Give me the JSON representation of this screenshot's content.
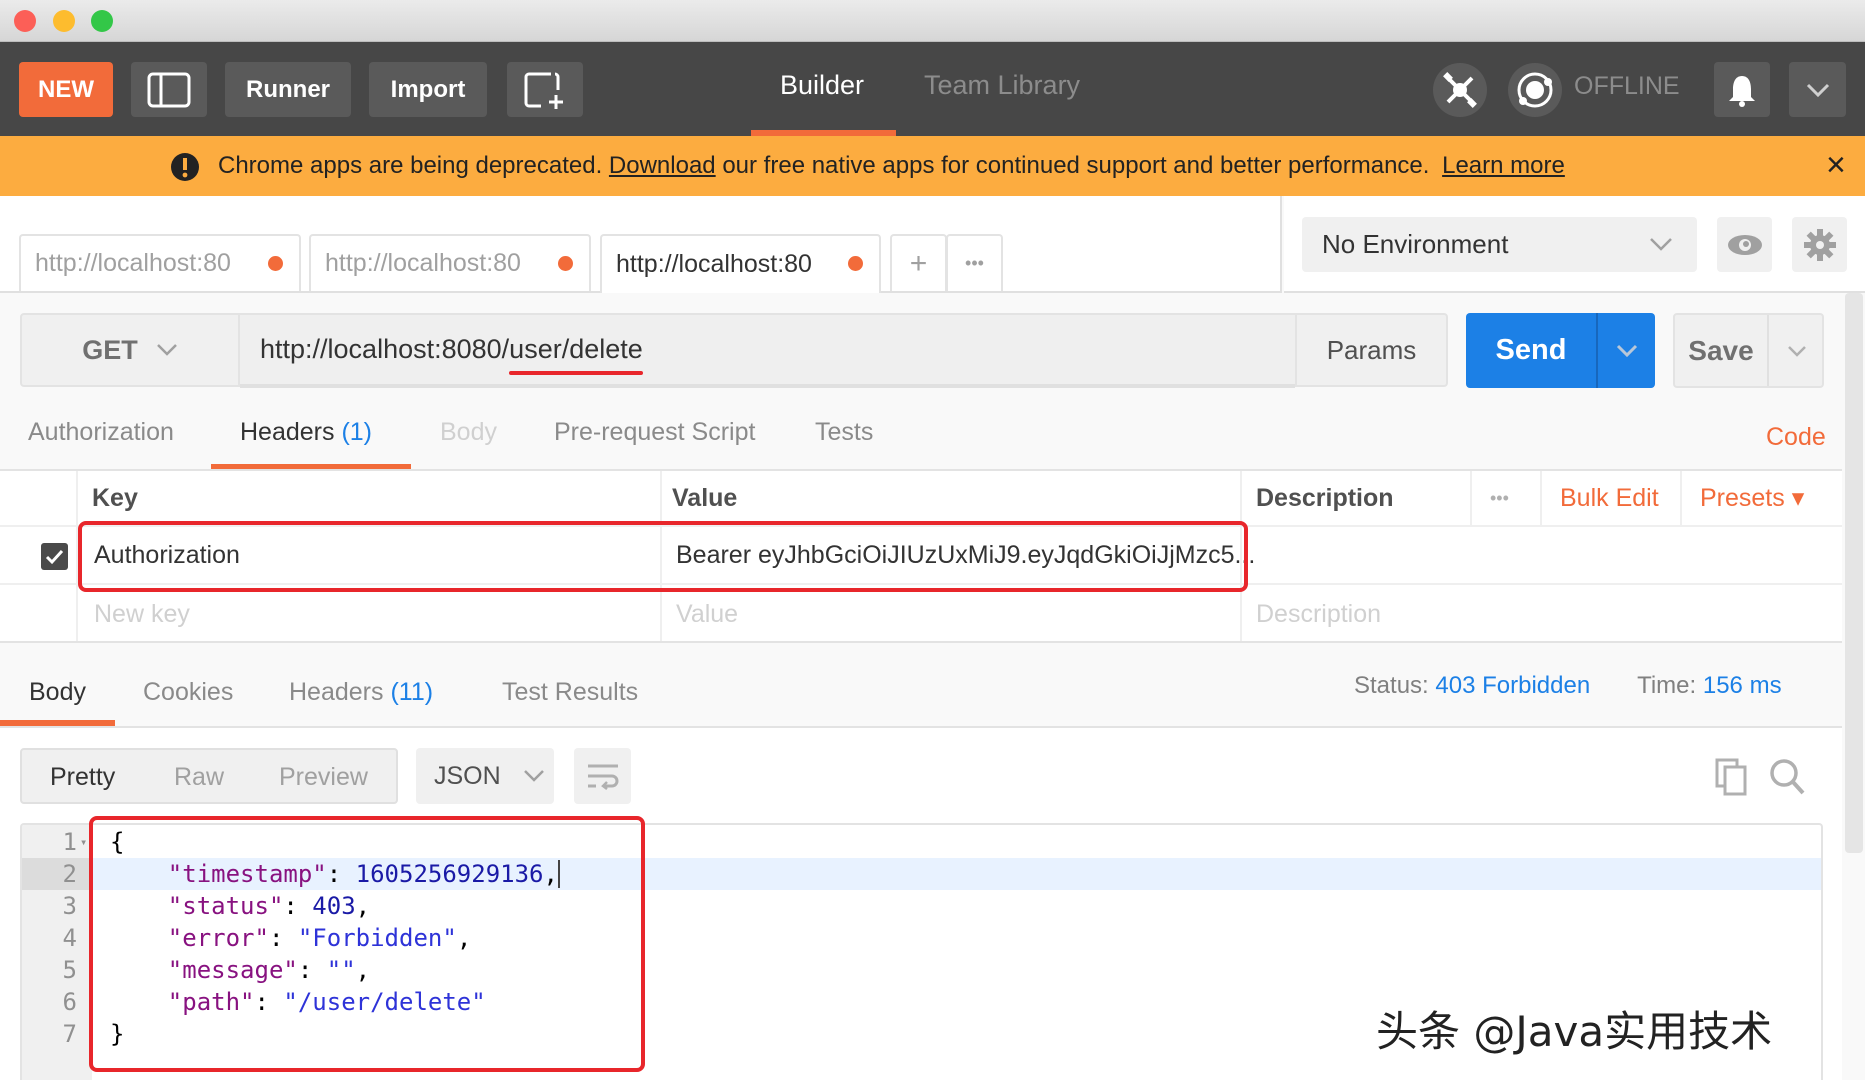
{
  "window": {
    "traffic_lights": [
      "#fc5f57",
      "#fdbc2e",
      "#33c748"
    ]
  },
  "topnav": {
    "new_label": "NEW",
    "runner_label": "Runner",
    "import_label": "Import",
    "tabs": [
      {
        "label": "Builder",
        "active": true
      },
      {
        "label": "Team Library",
        "active": false
      }
    ],
    "status_label": "OFFLINE",
    "accent": "#f26b3a"
  },
  "banner": {
    "text_before": "Chrome apps are being deprecated.",
    "download_link": "Download",
    "text_after": "our free native apps for continued support and better performance.",
    "learn_more_link": "Learn more",
    "close_label": "×"
  },
  "request_tabs": [
    {
      "label": "http://localhost:80",
      "active": false,
      "unsaved": true
    },
    {
      "label": "http://localhost:80",
      "active": false,
      "unsaved": true
    },
    {
      "label": "http://localhost:80",
      "active": true,
      "unsaved": true
    }
  ],
  "request_tab_actions": {
    "add": "+",
    "more": "•••"
  },
  "environment": {
    "selected": "No Environment"
  },
  "request": {
    "method": "GET",
    "url_base": "http://localhost:8080/",
    "url_path": "user/delete",
    "params_label": "Params",
    "send_label": "Send",
    "save_label": "Save"
  },
  "request_subtabs": [
    {
      "label": "Authorization",
      "count": null,
      "state": "normal"
    },
    {
      "label": "Headers",
      "count": "(1)",
      "state": "active"
    },
    {
      "label": "Body",
      "count": null,
      "state": "disabled"
    },
    {
      "label": "Pre-request Script",
      "count": null,
      "state": "normal"
    },
    {
      "label": "Tests",
      "count": null,
      "state": "normal"
    }
  ],
  "code_link": "Code",
  "headers_table": {
    "columns": [
      "Key",
      "Value",
      "Description"
    ],
    "more_label": "•••",
    "bulk_edit_label": "Bulk Edit",
    "presets_label": "Presets ▾",
    "rows": [
      {
        "enabled": true,
        "key": "Authorization",
        "value": "Bearer eyJhbGciOiJIUzUxMiJ9.eyJqdGkiOiJjMzc5...",
        "description": ""
      }
    ],
    "placeholders": {
      "key": "New key",
      "value": "Value",
      "description": "Description"
    }
  },
  "response_tabs": [
    {
      "label": "Body",
      "count": null,
      "active": true
    },
    {
      "label": "Cookies",
      "count": null,
      "active": false
    },
    {
      "label": "Headers",
      "count": "(11)",
      "active": false
    },
    {
      "label": "Test Results",
      "count": null,
      "active": false
    }
  ],
  "response_status": {
    "status_label": "Status:",
    "status_value": "403 Forbidden",
    "time_label": "Time:",
    "time_value": "156 ms"
  },
  "response_view": {
    "modes": [
      "Pretty",
      "Raw",
      "Preview"
    ],
    "active_mode": "Pretty",
    "format": "JSON"
  },
  "response_body": [
    {
      "n": "1",
      "parts": [
        [
          "p",
          "{"
        ]
      ]
    },
    {
      "n": "2",
      "parts": [
        [
          "p",
          "    "
        ],
        [
          "k",
          "\"timestamp\""
        ],
        [
          "p",
          ": "
        ],
        [
          "n",
          "1605256929136"
        ],
        [
          "p",
          ","
        ]
      ]
    },
    {
      "n": "3",
      "parts": [
        [
          "p",
          "    "
        ],
        [
          "k",
          "\"status\""
        ],
        [
          "p",
          ": "
        ],
        [
          "n",
          "403"
        ],
        [
          "p",
          ","
        ]
      ]
    },
    {
      "n": "4",
      "parts": [
        [
          "p",
          "    "
        ],
        [
          "k",
          "\"error\""
        ],
        [
          "p",
          ": "
        ],
        [
          "s",
          "\"Forbidden\""
        ],
        [
          "p",
          ","
        ]
      ]
    },
    {
      "n": "5",
      "parts": [
        [
          "p",
          "    "
        ],
        [
          "k",
          "\"message\""
        ],
        [
          "p",
          ": "
        ],
        [
          "s",
          "\"\""
        ],
        [
          "p",
          ","
        ]
      ]
    },
    {
      "n": "6",
      "parts": [
        [
          "p",
          "    "
        ],
        [
          "k",
          "\"path\""
        ],
        [
          "p",
          ": "
        ],
        [
          "s",
          "\"/user/delete\""
        ]
      ]
    },
    {
      "n": "7",
      "parts": [
        [
          "p",
          "}"
        ]
      ]
    }
  ],
  "watermark": "头条 @Java实用技术"
}
